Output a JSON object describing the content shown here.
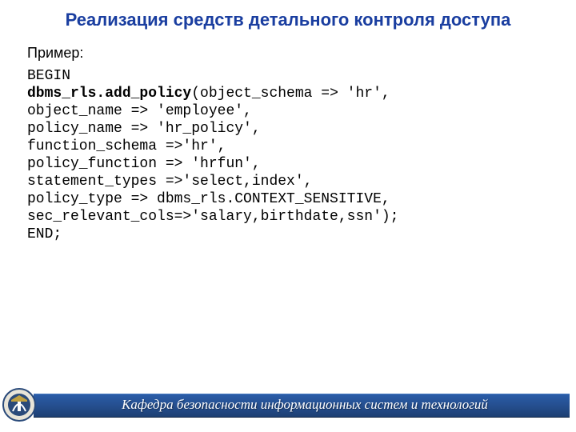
{
  "title": "Реализация средств детального контроля доступа",
  "example_label": "Пример:",
  "code": {
    "line1a": "BEGIN",
    "line2_bold": "dbms_rls.add_policy",
    "line2_rest": "(object_schema => 'hr',",
    "line3": "object_name => 'employee',",
    "line4": "policy_name => 'hr_policy',",
    "line5": "function_schema =>'hr',",
    "line6": "policy_function => 'hrfun',",
    "line7": "statement_types =>'select,index',",
    "line8": "policy_type => dbms_rls.CONTEXT_SENSITIVE,",
    "line9": "sec_relevant_cols=>'salary,birthdate,ssn');",
    "line10": "END;"
  },
  "footer": "Кафедра безопасности информационных систем и технологий"
}
